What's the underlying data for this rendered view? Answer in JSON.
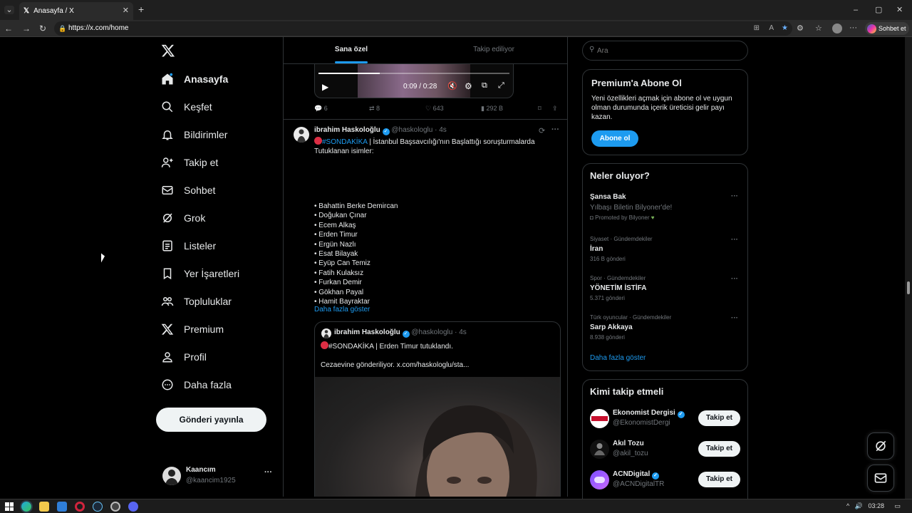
{
  "browser": {
    "tab_title": "Anasayfa / X",
    "url": "https://x.com/home",
    "copilot_label": "Sohbet et",
    "read_aloud": "A"
  },
  "nav": {
    "items": [
      {
        "label": "Anasayfa",
        "icon": "home-icon"
      },
      {
        "label": "Keşfet",
        "icon": "search-icon"
      },
      {
        "label": "Bildirimler",
        "icon": "bell-icon"
      },
      {
        "label": "Takip et",
        "icon": "person-add-icon"
      },
      {
        "label": "Sohbet",
        "icon": "mail-icon"
      },
      {
        "label": "Grok",
        "icon": "grok-icon"
      },
      {
        "label": "Listeler",
        "icon": "list-icon"
      },
      {
        "label": "Yer İşaretleri",
        "icon": "bookmark-icon"
      },
      {
        "label": "Topluluklar",
        "icon": "communities-icon"
      },
      {
        "label": "Premium",
        "icon": "x-logo-icon"
      },
      {
        "label": "Profil",
        "icon": "profile-icon"
      },
      {
        "label": "Daha fazla",
        "icon": "more-circle-icon"
      }
    ],
    "post_button": "Gönderi yayınla",
    "account": {
      "name": "Kaancım",
      "handle": "@kaancim1925",
      "more": "···"
    }
  },
  "feed": {
    "tabs": [
      "Sana özel",
      "Takip ediliyor"
    ],
    "video": {
      "time": "0:09 / 0:28",
      "progress": 0.32
    },
    "prev_actions": {
      "replies": "6",
      "reposts": "8",
      "likes": "643",
      "views": "292 B"
    },
    "tweet": {
      "name": "ibrahim Haskoloğlu",
      "handle": "@haskologlu",
      "time": "· 4s",
      "hashtag": "#SONDAKİKA",
      "lead": " | İstanbul Başsavcılığı'nın Başlattığı soruşturmalarda Tutuklanan isimler:",
      "names": [
        "• Bahattin Berke Demircan",
        "• Doğukan Çınar",
        "• Ecem Alkaş",
        "• Erden Timur",
        "• Ergün Nazlı",
        "• Esat Bilayak",
        "• Eyüp Can Temiz",
        "• Fatih Kulaksız",
        "• Furkan Demir",
        "• Gökhan Payal",
        "• Hamit Bayraktar"
      ],
      "show_more": "Daha fazla göster"
    },
    "quote": {
      "name": "ibrahim Haskoloğlu",
      "handle": "@haskologlu",
      "time": "· 4s",
      "hashtag": "#SONDAKİKA",
      "line1": " | Erden Timur tutuklandı.",
      "line2": "Cezaevine gönderiliyor.  x.com/haskologlu/sta..."
    }
  },
  "right": {
    "search_placeholder": "Ara",
    "premium": {
      "title": "Premium'a Abone Ol",
      "body": "Yeni özellikleri açmak için abone ol ve uygun olman durumunda içerik üreticisi gelir payı kazan.",
      "button": "Abone ol"
    },
    "trends": {
      "title": "Neler oluyor?",
      "promoted": {
        "title": "Şansa Bak",
        "subtitle": "Yılbaşı Biletin Bilyoner'de!",
        "promo": "Promoted by Bilyoner"
      },
      "items": [
        {
          "context": "Siyaset · Gündemdekiler",
          "topic": "İran",
          "count": "316 B gönderi"
        },
        {
          "context": "Spor · Gündemdekiler",
          "topic": "YÖNETİM İSTİFA",
          "count": "5.371 gönderi"
        },
        {
          "context": "Türk oyuncular · Gündemdekiler",
          "topic": "Sarp Akkaya",
          "count": "8.938 gönderi"
        }
      ],
      "show_more": "Daha fazla göster"
    },
    "who_to_follow": {
      "title": "Kimi takip etmeli",
      "accounts": [
        {
          "name": "Ekonomist Dergisi",
          "handle": "@EkonomistDergi",
          "verified": true,
          "avatar_text": "Ekonomist"
        },
        {
          "name": "Akıl Tozu",
          "handle": "@akil_tozu",
          "verified": false,
          "avatar_text": "AKIL TOZU"
        },
        {
          "name": "ACNDigital",
          "handle": "@ACNDigitalTR",
          "verified": true,
          "avatar_text": ""
        }
      ],
      "follow_label": "Takip et"
    }
  },
  "taskbar": {
    "time": "03:28"
  },
  "colors": {
    "accent": "#1d9bf0",
    "bg": "#000000",
    "muted": "#71767b",
    "border": "#2f3336"
  }
}
